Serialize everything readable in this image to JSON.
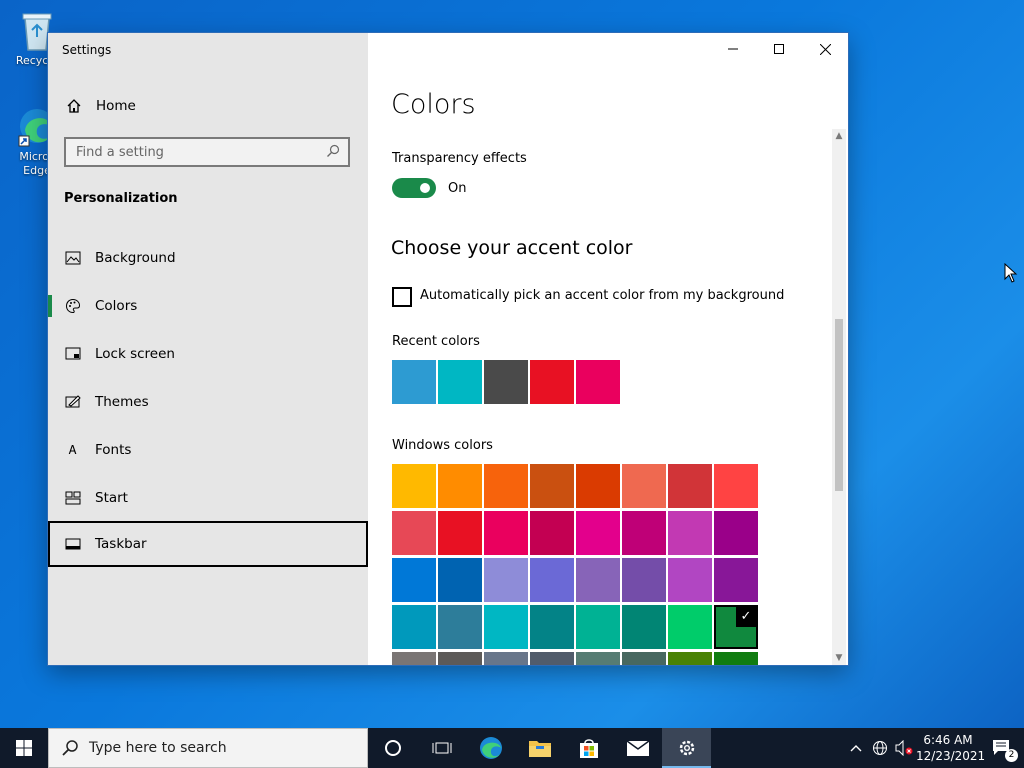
{
  "desktop": {
    "icons": [
      {
        "label": "Recycle"
      },
      {
        "label": "Micros\nEdge"
      }
    ]
  },
  "window": {
    "title": "Settings",
    "minimize_icon": "minimize-icon",
    "maximize_icon": "maximize-icon",
    "close_icon": "close-icon"
  },
  "sidebar": {
    "home_label": "Home",
    "search_placeholder": "Find a setting",
    "group_heading": "Personalization",
    "items": [
      {
        "label": "Background",
        "icon": "picture-icon"
      },
      {
        "label": "Colors",
        "icon": "palette-icon",
        "active": true
      },
      {
        "label": "Lock screen",
        "icon": "lock-screen-icon"
      },
      {
        "label": "Themes",
        "icon": "themes-icon"
      },
      {
        "label": "Fonts",
        "icon": "fonts-icon"
      },
      {
        "label": "Start",
        "icon": "start-icon"
      },
      {
        "label": "Taskbar",
        "icon": "taskbar-icon",
        "focused": true
      }
    ]
  },
  "main": {
    "title": "Colors",
    "transparency": {
      "label": "Transparency effects",
      "state": "On",
      "on": true
    },
    "accent_heading": "Choose your accent color",
    "auto_pick": {
      "label": "Automatically pick an accent color from my background",
      "checked": false
    },
    "recent_heading": "Recent colors",
    "recent_colors": [
      "#2d9bd2",
      "#00b7c3",
      "#4a4a4a",
      "#e81123",
      "#ea005e"
    ],
    "windows_heading": "Windows colors",
    "windows_colors": [
      [
        "#ffb900",
        "#ff8c00",
        "#f7630c",
        "#ca5010",
        "#da3b01",
        "#ef6950",
        "#d13438",
        "#ff4343"
      ],
      [
        "#e74856",
        "#e81123",
        "#ea005e",
        "#c30052",
        "#e3008c",
        "#bf0077",
        "#c239b3",
        "#9a0089"
      ],
      [
        "#0078d7",
        "#0063b1",
        "#8e8cd8",
        "#6b69d6",
        "#8764b8",
        "#744da9",
        "#b146c2",
        "#881798"
      ],
      [
        "#0099bc",
        "#2d7d9a",
        "#00b7c3",
        "#038387",
        "#00b294",
        "#018574",
        "#00cc6a",
        "#10893e"
      ],
      [
        "#7a7574",
        "#5d5a58",
        "#68768a",
        "#515c6b",
        "#567c73",
        "#486860",
        "#498205",
        "#107c10"
      ]
    ],
    "selected_color": "#10893e"
  },
  "taskbar": {
    "search_placeholder": "Type here to search",
    "apps": [
      "cortana-icon",
      "task-view-icon",
      "edge-icon",
      "file-explorer-icon",
      "store-icon",
      "mail-icon",
      "settings-icon"
    ],
    "active_app": "settings-icon",
    "time": "6:46 AM",
    "date": "12/23/2021",
    "notification_count": "2"
  }
}
